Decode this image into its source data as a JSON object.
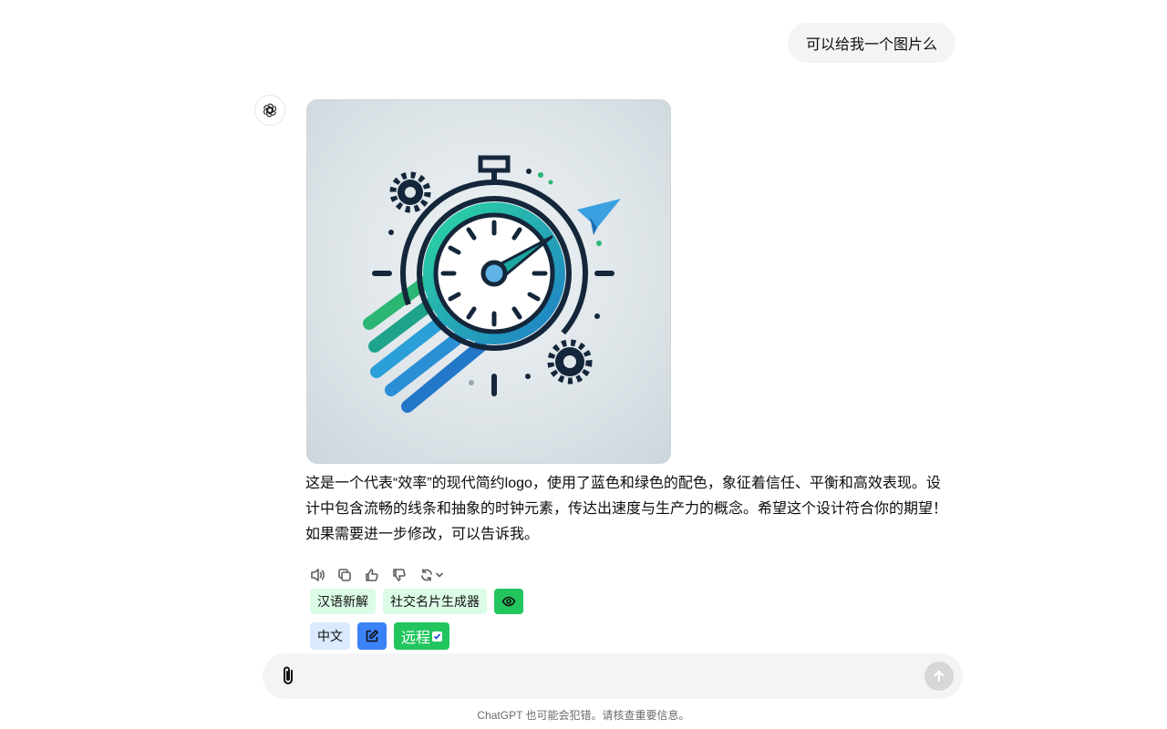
{
  "conversation": {
    "user_message": "可以给我一个图片么",
    "assistant_text": "这是一个代表“效率”的现代简约logo，使用了蓝色和绿色的配色，象征着信任、平衡和高效表现。设计中包含流畅的线条和抽象的时钟元素，传达出速度与生产力的概念。希望这个设计符合你的期望！如果需要进一步修改，可以告诉我。"
  },
  "actions": {
    "icons": [
      "speaker-icon",
      "copy-icon",
      "thumbs-up-icon",
      "thumbs-down-icon",
      "regenerate-icon",
      "chevron-down-icon"
    ]
  },
  "extension_chips": {
    "row1": [
      "汉语新解",
      "社交名片生成器"
    ],
    "row2_lang": "中文",
    "remote_label": "远程",
    "colors": {
      "chip_green_light": "#dcfce7",
      "chip_green": "#22c55e",
      "chip_blue_light": "#dbeafe",
      "chip_blue": "#3b82f6"
    }
  },
  "composer": {
    "placeholder": "",
    "value": ""
  },
  "footer": {
    "disclaimer": "ChatGPT 也可能会犯错。请核查重要信息。"
  }
}
